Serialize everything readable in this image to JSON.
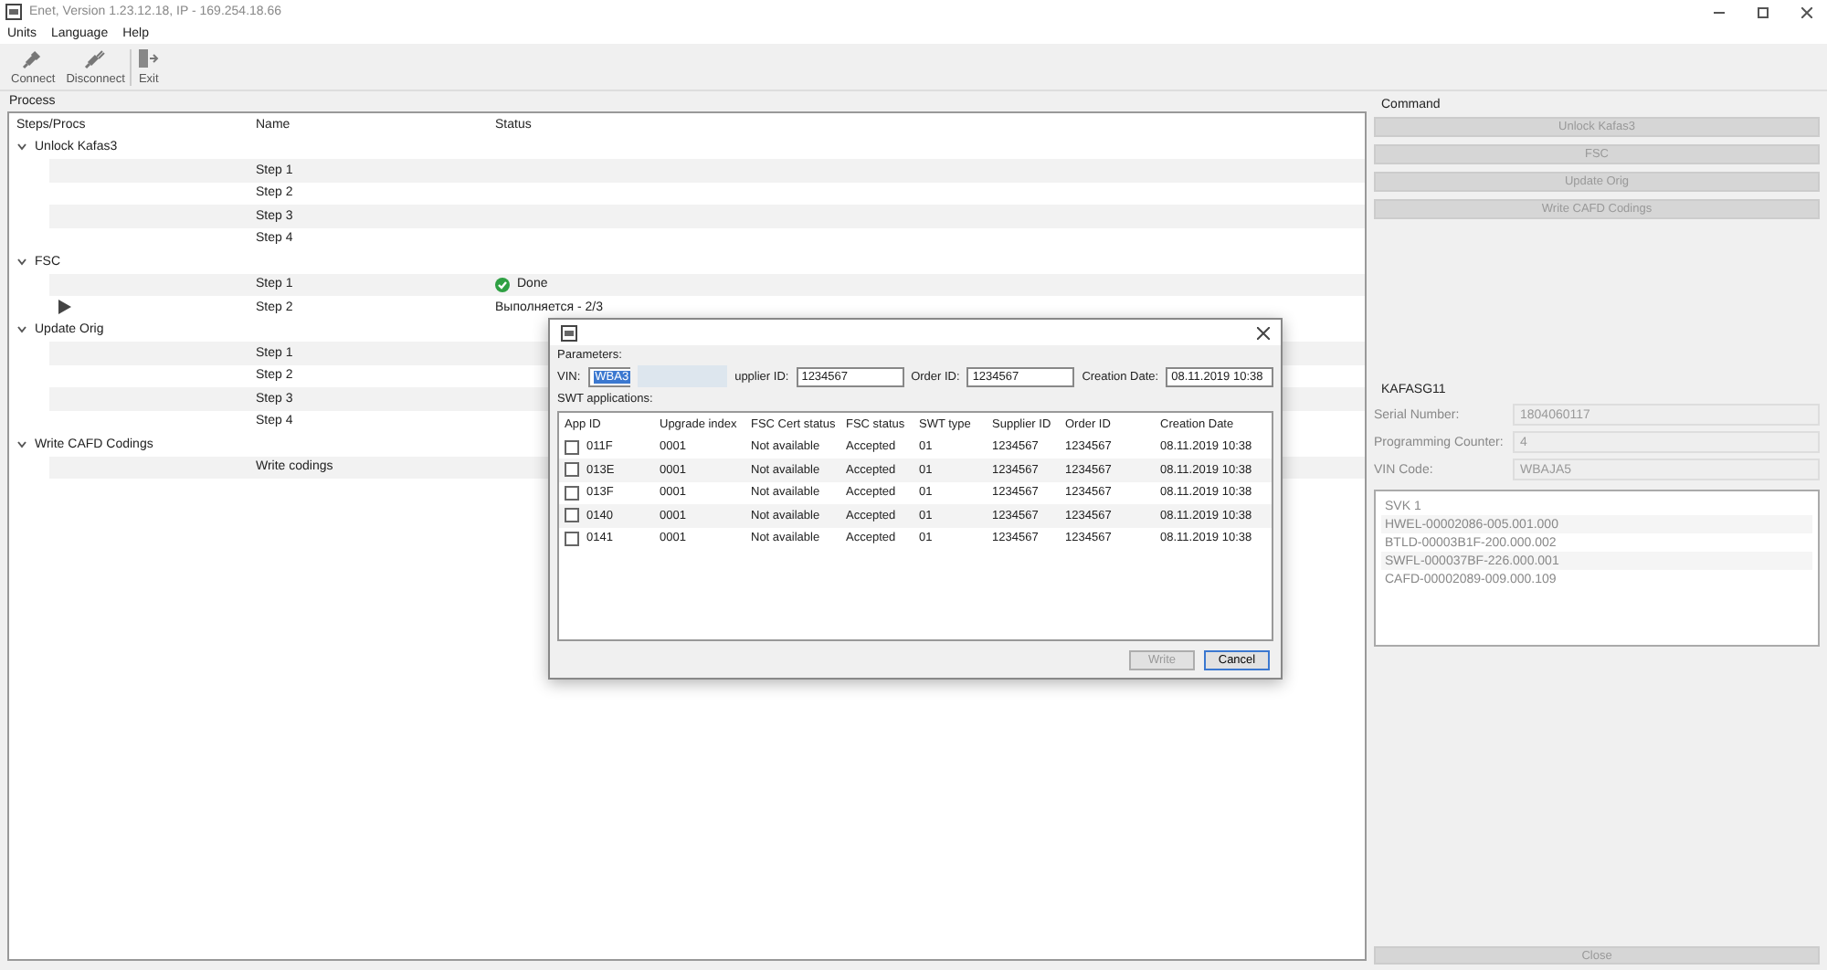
{
  "window": {
    "title": "Enet, Version 1.23.12.18, IP - 169.254.18.66"
  },
  "menu": [
    "Units",
    "Language",
    "Help"
  ],
  "toolbar": [
    {
      "label": "Connect",
      "kind": "plug"
    },
    {
      "label": "Disconnect",
      "kind": "unplug"
    },
    {
      "label": "Exit",
      "kind": "exit"
    }
  ],
  "process": {
    "title": "Process",
    "columns": [
      "Steps/Procs",
      "Name",
      "Status"
    ],
    "groups": [
      {
        "label": "Unlock Kafas3",
        "expanded": true,
        "children": [
          {
            "label": "Step 1",
            "done": false,
            "current": false
          },
          {
            "label": "Step 2",
            "done": false,
            "current": false
          },
          {
            "label": "Step 3",
            "done": false,
            "current": false
          },
          {
            "label": "Step 4",
            "done": false,
            "current": false
          }
        ]
      },
      {
        "label": "FSC",
        "expanded": true,
        "children": [
          {
            "label": "Step 1",
            "done": true,
            "current": false,
            "status": "Done"
          },
          {
            "label": "Step 2",
            "done": false,
            "current": true,
            "status": "Выполняется - 2/3"
          }
        ]
      },
      {
        "label": "Update Orig",
        "expanded": true,
        "children": [
          {
            "label": "Step 1",
            "done": false,
            "current": false
          },
          {
            "label": "Step 2",
            "done": false,
            "current": false
          },
          {
            "label": "Step 3",
            "done": false,
            "current": false
          },
          {
            "label": "Step 4",
            "done": false,
            "current": false
          }
        ]
      },
      {
        "label": "Write CAFD Codings",
        "expanded": true,
        "children": [
          {
            "label": "Write codings",
            "done": false,
            "current": false
          }
        ]
      }
    ]
  },
  "command": {
    "title": "Command",
    "buttons": [
      {
        "label": "Unlock Kafas3",
        "disabled": true
      },
      {
        "label": "FSC",
        "disabled": true
      },
      {
        "label": "Update Orig",
        "disabled": true
      },
      {
        "label": "Write CAFD Codings",
        "disabled": true
      }
    ]
  },
  "ecu": {
    "title": "KAFASG11",
    "fields": [
      {
        "label": "Serial Number:",
        "value": "1804060117"
      },
      {
        "label": "Programming Counter:",
        "value": "4"
      },
      {
        "label": "VIN Code:",
        "value": "WBAJA5"
      }
    ],
    "svk": {
      "title": "SVK 1",
      "items": [
        "HWEL-00002086-005.001.000",
        "BTLD-00003B1F-200.000.002",
        "SWFL-000037BF-226.000.001",
        "CAFD-00002089-009.000.109"
      ]
    }
  },
  "close_button": {
    "label": "Close",
    "disabled": true
  },
  "dialog": {
    "parameters_title": "Parameters:",
    "vin": {
      "label": "VIN:",
      "value": "WBA3"
    },
    "fields": [
      {
        "label": "upplier ID:",
        "value": "1234567"
      },
      {
        "label": "Order ID:",
        "value": "1234567"
      },
      {
        "label": "Creation Date:",
        "value": "08.11.2019 10:38"
      }
    ],
    "table_title": "SWT applications:",
    "columns": [
      "App ID",
      "Upgrade index",
      "FSC Cert status",
      "FSC status",
      "SWT type",
      "Supplier ID",
      "Order ID",
      "Creation Date"
    ],
    "rows": [
      {
        "checked": false,
        "cells": [
          "011F",
          "0001",
          "Not available",
          "Accepted",
          "01",
          "1234567",
          "1234567",
          "08.11.2019 10:38"
        ]
      },
      {
        "checked": false,
        "cells": [
          "013E",
          "0001",
          "Not available",
          "Accepted",
          "01",
          "1234567",
          "1234567",
          "08.11.2019 10:38"
        ]
      },
      {
        "checked": false,
        "cells": [
          "013F",
          "0001",
          "Not available",
          "Accepted",
          "01",
          "1234567",
          "1234567",
          "08.11.2019 10:38"
        ]
      },
      {
        "checked": false,
        "cells": [
          "0140",
          "0001",
          "Not available",
          "Accepted",
          "01",
          "1234567",
          "1234567",
          "08.11.2019 10:38"
        ]
      },
      {
        "checked": false,
        "cells": [
          "0141",
          "0001",
          "Not available",
          "Accepted",
          "01",
          "1234567",
          "1234567",
          "08.11.2019 10:38"
        ]
      }
    ],
    "buttons": [
      {
        "label": "Write",
        "disabled": true
      },
      {
        "label": "Cancel",
        "disabled": false
      }
    ]
  }
}
